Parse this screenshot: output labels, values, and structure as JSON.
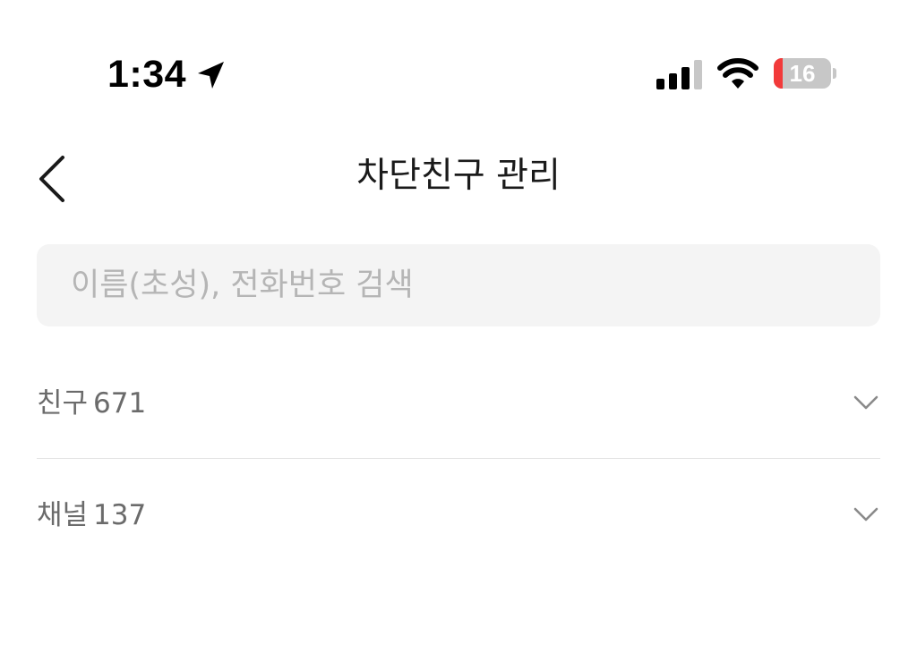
{
  "status_bar": {
    "time": "1:34",
    "battery_level": "16",
    "battery_fraction": 0.16,
    "icons": [
      "location-arrow-icon",
      "cellular-signal-icon",
      "wifi-icon",
      "battery-icon"
    ],
    "battery_low_color": "#f23a3a"
  },
  "header": {
    "title": "차단친구 관리",
    "back_icon": "chevron-left-icon"
  },
  "search": {
    "placeholder": "이름(초성), 전화번호 검색",
    "value": ""
  },
  "sections": {
    "friends": {
      "label": "친구",
      "count": "671",
      "icon": "chevron-down-icon"
    },
    "channels": {
      "label": "채널",
      "count": "137",
      "icon": "chevron-down-icon"
    }
  }
}
